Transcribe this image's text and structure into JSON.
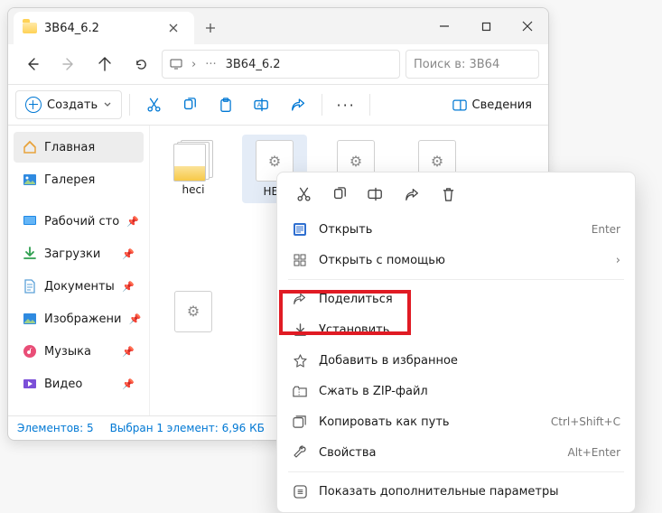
{
  "tab": {
    "title": "3B64_6.2"
  },
  "path": {
    "segment": "3B64_6.2"
  },
  "search": {
    "placeholder": "Поиск в: 3B64"
  },
  "toolbar": {
    "create": "Создать",
    "details": "Сведения"
  },
  "sidebar": {
    "home": "Главная",
    "gallery": "Галерея",
    "desktop": "Рабочий сто",
    "downloads": "Загрузки",
    "documents": "Документы",
    "pictures": "Изображени",
    "music": "Музыка",
    "videos": "Видео"
  },
  "files": {
    "f1": "heci",
    "f2": "HEC",
    "f3": "",
    "f4": "",
    "f5": ""
  },
  "status": {
    "count": "Элементов: 5",
    "selected": "Выбран 1 элемент: 6,96 КБ"
  },
  "ctx": {
    "open": "Открыть",
    "open_kb": "Enter",
    "open_with": "Открыть с помощью",
    "share": "Поделиться",
    "install": "Установить",
    "fav": "Добавить в избранное",
    "zip": "Сжать в ZIP-файл",
    "copy_path": "Копировать как путь",
    "copy_path_kb": "Ctrl+Shift+C",
    "props": "Свойства",
    "props_kb": "Alt+Enter",
    "more": "Показать дополнительные параметры"
  }
}
